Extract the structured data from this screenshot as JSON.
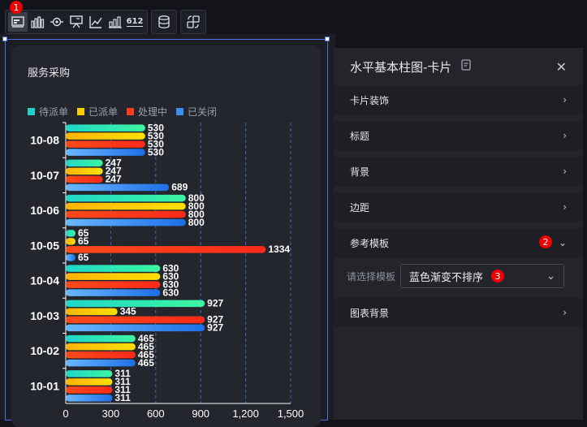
{
  "toolbar": {
    "badge": "1",
    "groups": [
      [
        "card-chart",
        "bar-chart",
        "eye-target",
        "presentation",
        "line-axes",
        "column-chart",
        "number-612"
      ],
      [
        "database"
      ],
      [
        "transform"
      ]
    ],
    "number_icon_text": "612"
  },
  "chart": {
    "card_title": "服务采购",
    "legend": [
      {
        "label": "待派单",
        "color": "#22d3c5"
      },
      {
        "label": "已派单",
        "color": "#ffcc00"
      },
      {
        "label": "处理中",
        "color": "#ff3b1f"
      },
      {
        "label": "已关闭",
        "color": "#3b8df2"
      }
    ]
  },
  "chart_data": {
    "type": "bar",
    "orientation": "horizontal",
    "categories": [
      "10-08",
      "10-07",
      "10-06",
      "10-05",
      "10-04",
      "10-03",
      "10-02",
      "10-01"
    ],
    "series": [
      {
        "name": "待派单",
        "values": [
          530,
          247,
          800,
          65,
          630,
          927,
          465,
          311
        ]
      },
      {
        "name": "已派单",
        "values": [
          530,
          247,
          800,
          65,
          630,
          345,
          465,
          311
        ]
      },
      {
        "name": "处理中",
        "values": [
          530,
          247,
          800,
          1334,
          630,
          927,
          465,
          311
        ]
      },
      {
        "name": "已关闭",
        "values": [
          530,
          689,
          800,
          65,
          630,
          927,
          465,
          311
        ]
      }
    ],
    "xlim": [
      0,
      1500
    ],
    "xticks": [
      "0",
      "300",
      "600",
      "900",
      "1,200",
      "1,500"
    ],
    "grid": "vertical dashed",
    "legend_position": "top-left"
  },
  "panel": {
    "title": "水平基本柱图-卡片",
    "items": [
      {
        "label": "卡片装饰"
      },
      {
        "label": "标题"
      },
      {
        "label": "背景"
      },
      {
        "label": "边距"
      }
    ],
    "template": {
      "label": "参考模板",
      "badge": "2",
      "select_label": "请选择模板",
      "select_value": "蓝色渐变不排序",
      "select_badge": "3"
    },
    "chart_bg_label": "图表背景"
  }
}
